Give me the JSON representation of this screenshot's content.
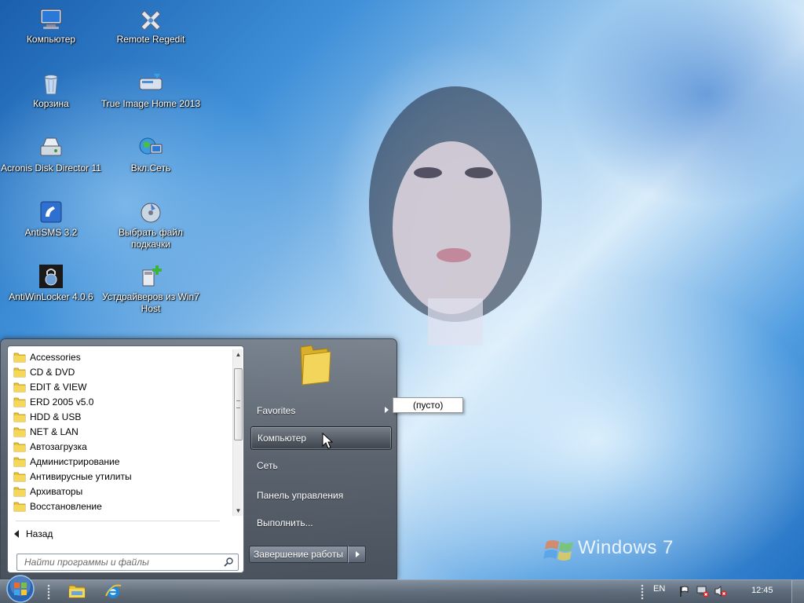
{
  "desktop": {
    "icons": [
      {
        "label": "Компьютер",
        "icon": "computer-icon"
      },
      {
        "label": "Remote Regedit",
        "icon": "regedit-icon"
      },
      {
        "label": "Корзина",
        "icon": "recycle-bin-icon"
      },
      {
        "label": "True Image Home 2013",
        "icon": "true-image-icon"
      },
      {
        "label": "Acronis Disk Director 11",
        "icon": "disk-director-icon"
      },
      {
        "label": "Вкл.Сеть",
        "icon": "network-globe-icon"
      },
      {
        "label": "AntiSMS 3.2",
        "icon": "antisms-icon"
      },
      {
        "label": "Выбрать файл подкачки",
        "icon": "pagefile-icon"
      },
      {
        "label": "AntiWinLocker 4.0.6",
        "icon": "padlock-icon"
      },
      {
        "label": "Устдрайверов из Win7 Host",
        "icon": "driver-install-icon"
      }
    ],
    "watermark": "Windows 7"
  },
  "start_menu": {
    "programs": [
      "Accessories",
      "CD & DVD",
      "EDIT & VIEW",
      "ERD 2005 v5.0",
      "HDD & USB",
      "NET & LAN",
      "Автозагрузка",
      "Администрирование",
      "Антивирусные утилиты",
      "Архиваторы",
      "Восстановление"
    ],
    "back_label": "Назад",
    "search_placeholder": "Найти программы и файлы",
    "right_items": {
      "favorites": "Favorites",
      "computer": "Компьютер",
      "network": "Сеть",
      "control_panel": "Панель управления",
      "run": "Выполнить..."
    },
    "shutdown_label": "Завершение работы",
    "favorites_submenu": "(пусто)"
  },
  "taskbar": {
    "language": "EN",
    "clock": "12:45",
    "pinned": [
      "explorer-folder-icon",
      "internet-explorer-icon"
    ],
    "tray": [
      "flag-icon",
      "network-disconnected-icon",
      "volume-muted-icon"
    ]
  },
  "colors": {
    "taskbar": "#5c6672",
    "menu_hover": "#3c424a",
    "folder": "#e9c53a"
  }
}
